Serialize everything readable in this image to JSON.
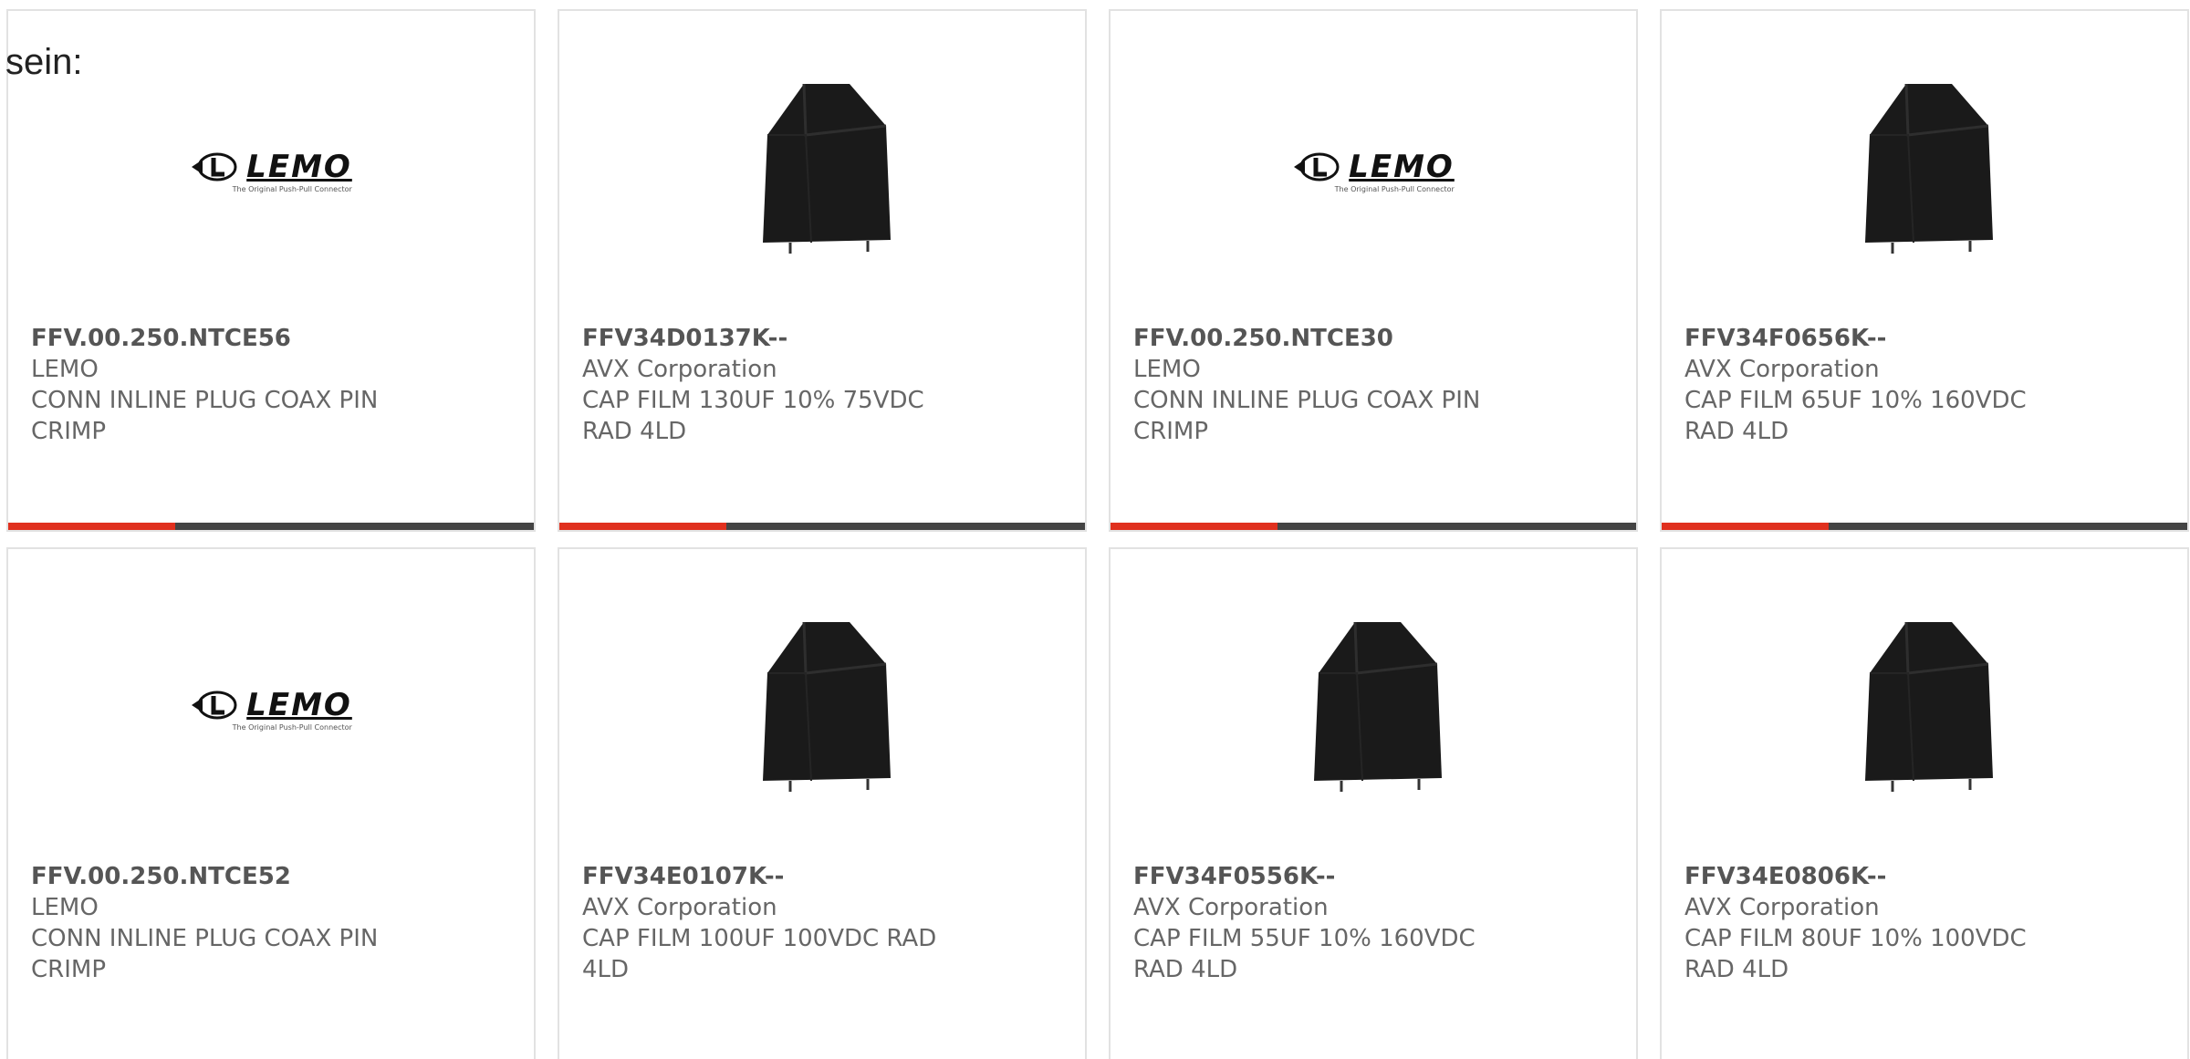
{
  "intro_text": "sein:",
  "colors": {
    "accent": "#e0301e",
    "bar_dark": "#444444",
    "card_border": "#e2e2e2",
    "text": "#666666"
  },
  "lemo_logo": {
    "word": "LEMO",
    "tagline": "The Original Push-Pull Connector"
  },
  "products": [
    {
      "part_number": "FFV.00.250.NTCE56",
      "manufacturer": "LEMO",
      "description": "CONN INLINE PLUG COAX PIN CRIMP",
      "image": "lemo-logo"
    },
    {
      "part_number": "FFV34D0137K--",
      "manufacturer": "AVX Corporation",
      "description": "CAP FILM 130UF 10% 75VDC RAD 4LD",
      "image": "film-capacitor"
    },
    {
      "part_number": "FFV.00.250.NTCE30",
      "manufacturer": "LEMO",
      "description": "CONN INLINE PLUG COAX PIN CRIMP",
      "image": "lemo-logo"
    },
    {
      "part_number": "FFV34F0656K--",
      "manufacturer": "AVX Corporation",
      "description": "CAP FILM 65UF 10% 160VDC RAD 4LD",
      "image": "film-capacitor"
    },
    {
      "part_number": "FFV.00.250.NTCE52",
      "manufacturer": "LEMO",
      "description": "CONN INLINE PLUG COAX PIN CRIMP",
      "image": "lemo-logo"
    },
    {
      "part_number": "FFV34E0107K--",
      "manufacturer": "AVX Corporation",
      "description": "CAP FILM 100UF 100VDC RAD 4LD",
      "image": "film-capacitor"
    },
    {
      "part_number": "FFV34F0556K--",
      "manufacturer": "AVX Corporation",
      "description": "CAP FILM 55UF 10% 160VDC RAD 4LD",
      "image": "film-capacitor"
    },
    {
      "part_number": "FFV34E0806K--",
      "manufacturer": "AVX Corporation",
      "description": "CAP FILM 80UF 10% 100VDC RAD 4LD",
      "image": "film-capacitor"
    }
  ]
}
